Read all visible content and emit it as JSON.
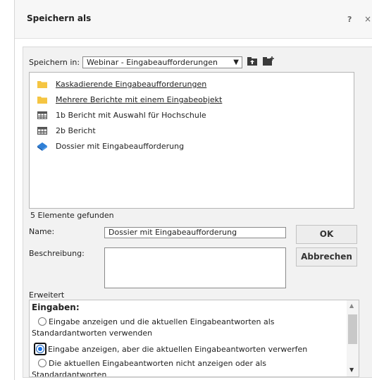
{
  "dialog": {
    "title": "Speichern als",
    "help_label": "?",
    "close_label": "×"
  },
  "location": {
    "label": "Speichern in:",
    "selected": "Webinar - Eingabeaufforderungen"
  },
  "file_list": [
    {
      "name": "Kaskadierende Eingabeaufforderungen",
      "icon": "folder-icon"
    },
    {
      "name": "Mehrere Berichte mit einem Eingabeobjekt",
      "icon": "folder-icon"
    },
    {
      "name": "1b Bericht mit Auswahl für Hochschule",
      "icon": "report-grid-icon"
    },
    {
      "name": "2b Bericht",
      "icon": "report-grid-icon"
    },
    {
      "name": "Dossier mit Eingabeaufforderung",
      "icon": "dossier-icon"
    }
  ],
  "status": {
    "count_text": "5 Elemente gefunden"
  },
  "form": {
    "name_label": "Name:",
    "name_value": "Dossier mit Eingabeaufforderung",
    "description_label": "Beschreibung:",
    "description_value": ""
  },
  "buttons": {
    "ok": "OK",
    "cancel": "Abbrechen"
  },
  "advanced": {
    "label": "Erweitert",
    "heading": "Eingaben:",
    "options": [
      {
        "text": "Eingabe anzeigen und die aktuellen Eingabeantworten als Standardantworten verwenden",
        "selected": false
      },
      {
        "text": "Eingabe anzeigen, aber die aktuellen Eingabeantworten verwerfen",
        "selected": true
      },
      {
        "text": "Die aktuellen Eingabeantworten nicht anzeigen oder als Standardantworten",
        "selected": false
      }
    ]
  },
  "colors": {
    "folder": "#f5c542",
    "accent": "#1a73e8",
    "dossier": "#2f7fd6"
  }
}
